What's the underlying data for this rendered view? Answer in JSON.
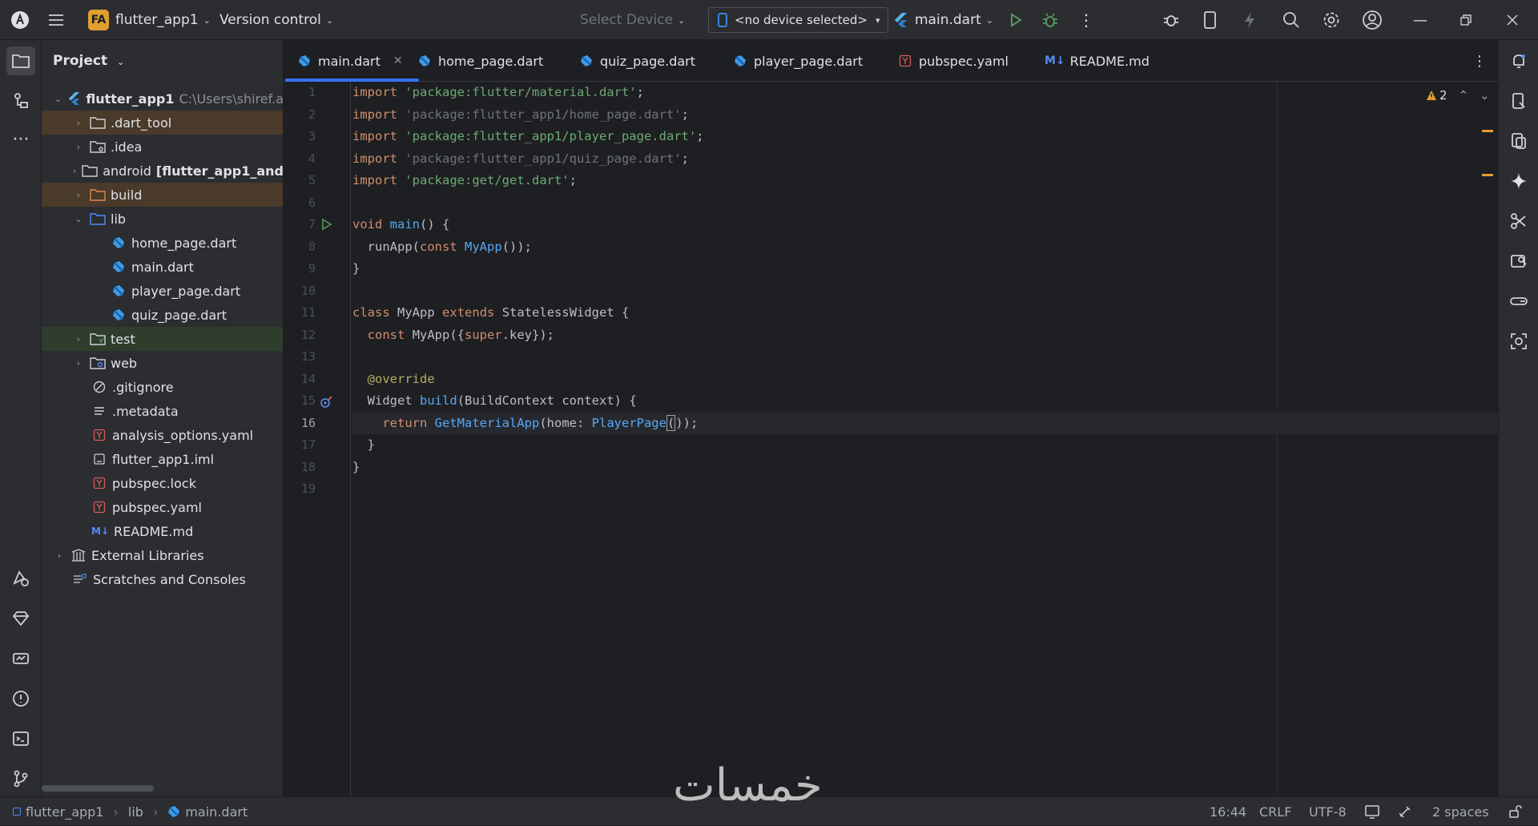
{
  "titlebar": {
    "project_badge": "FA",
    "project_name": "flutter_app1",
    "vcs_label": "Version control",
    "select_device": "Select Device",
    "device_selected": "<no device selected>",
    "run_config": "main.dart"
  },
  "project_panel": {
    "title": "Project",
    "root_name": "flutter_app1",
    "root_path": "C:\\Users\\shiref.a",
    "items": [
      {
        "label": ".dart_tool",
        "icon": "folder-icon"
      },
      {
        "label": ".idea",
        "icon": "folder-config-icon"
      },
      {
        "label": "android",
        "extra": "[flutter_app1_and",
        "icon": "folder-icon"
      },
      {
        "label": "build",
        "icon": "folder-excluded-icon"
      },
      {
        "label": "lib",
        "icon": "folder-source-icon"
      },
      {
        "label": "home_page.dart",
        "icon": "dart-file-icon"
      },
      {
        "label": "main.dart",
        "icon": "dart-file-icon"
      },
      {
        "label": "player_page.dart",
        "icon": "dart-file-icon"
      },
      {
        "label": "quiz_page.dart",
        "icon": "dart-file-icon"
      },
      {
        "label": "test",
        "icon": "folder-test-icon"
      },
      {
        "label": "web",
        "icon": "folder-web-icon"
      },
      {
        "label": ".gitignore",
        "icon": "ignore-file-icon"
      },
      {
        "label": ".metadata",
        "icon": "text-file-icon"
      },
      {
        "label": "analysis_options.yaml",
        "icon": "yaml-file-icon"
      },
      {
        "label": "flutter_app1.iml",
        "icon": "iml-file-icon"
      },
      {
        "label": "pubspec.lock",
        "icon": "yaml-file-icon"
      },
      {
        "label": "pubspec.yaml",
        "icon": "yaml-file-icon"
      },
      {
        "label": "README.md",
        "icon": "markdown-file-icon",
        "badge": "M↓"
      },
      {
        "label": "External Libraries",
        "icon": "library-icon"
      },
      {
        "label": "Scratches and Consoles",
        "icon": "scratches-icon"
      }
    ]
  },
  "tabs": [
    {
      "label": "main.dart"
    },
    {
      "label": "home_page.dart"
    },
    {
      "label": "quiz_page.dart"
    },
    {
      "label": "player_page.dart"
    },
    {
      "label": "pubspec.yaml",
      "badge": "Y"
    },
    {
      "label": "README.md",
      "badge": "M↓"
    }
  ],
  "editor": {
    "warning_count": "2",
    "line_numbers": [
      "1",
      "2",
      "3",
      "4",
      "5",
      "6",
      "7",
      "8",
      "9",
      "10",
      "11",
      "12",
      "13",
      "14",
      "15",
      "16",
      "17",
      "18",
      "19"
    ],
    "code": {
      "l1_kw": "import",
      "l1_str": "'package:flutter/material.dart'",
      "l1_end": ";",
      "l2_kw": "import",
      "l2_str": "'package:flutter_app1/home_page.dart'",
      "l2_end": ";",
      "l3_kw": "import",
      "l3_str": "'package:flutter_app1/player_page.dart'",
      "l3_end": ";",
      "l4_kw": "import",
      "l4_str": "'package:flutter_app1/quiz_page.dart'",
      "l4_end": ";",
      "l5_kw": "import",
      "l5_str": "'package:get/get.dart'",
      "l5_end": ";",
      "l7_kw": "void",
      "l7_fn": "main",
      "l7_rest": "() {",
      "l8_a": "runApp(",
      "l8_kw": "const",
      "l8_cls": "MyApp",
      "l8_end": "());",
      "l9": "}",
      "l11_kw": "class",
      "l11_cls": "MyApp",
      "l11_kw2": "extends",
      "l11_rest": "StatelessWidget {",
      "l12_kw": "const",
      "l12_a": "MyApp({",
      "l12_kw2": "super",
      "l12_end": ".key});",
      "l14_ann": "@override",
      "l15_a": "Widget",
      "l15_fn": "build",
      "l15_rest": "(BuildContext context) {",
      "l16_kw": "return",
      "l16_fn": "GetMaterialApp",
      "l16_a": "(home: ",
      "l16_cls": "PlayerPage",
      "l16_caret": "(",
      "l16_end": "));",
      "l17": "}",
      "l18": "}"
    }
  },
  "statusbar": {
    "breadcrumb_project": "flutter_app1",
    "breadcrumb_dir": "lib",
    "breadcrumb_file": "main.dart",
    "position": "16:44",
    "line_ending": "CRLF",
    "encoding": "UTF-8",
    "indent": "2 spaces"
  },
  "watermark": "خمسات"
}
